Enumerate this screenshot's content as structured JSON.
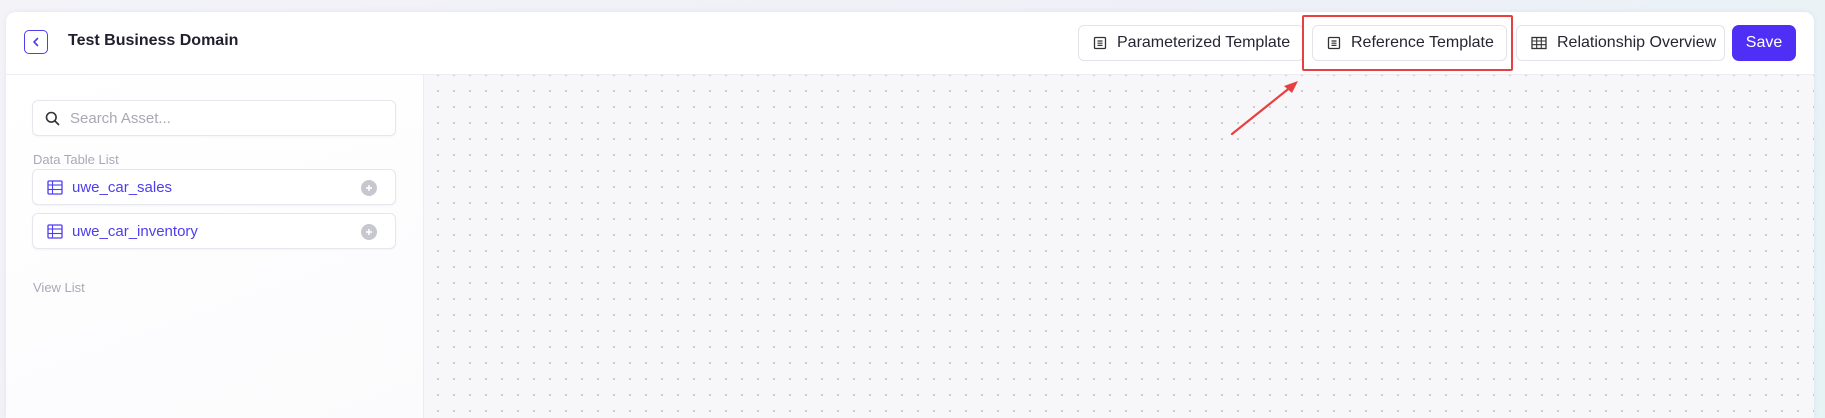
{
  "header": {
    "title": "Test Business Domain",
    "buttons": {
      "parameterized": "Parameterized Template",
      "reference": "Reference Template",
      "relationship": "Relationship Overview",
      "save": "Save"
    }
  },
  "sidebar": {
    "search_placeholder": "Search Asset...",
    "data_table_label": "Data Table List",
    "tables": [
      {
        "name": "uwe_car_sales"
      },
      {
        "name": "uwe_car_inventory"
      }
    ],
    "view_label": "View List"
  },
  "colors": {
    "accent": "#4f3df0",
    "save_bg": "#4f2ff5",
    "highlight": "#e84040"
  },
  "icons": {
    "back": "chevron-left-icon",
    "search": "search-icon",
    "template": "template-icon",
    "table": "table-icon",
    "add": "plus-circle-icon"
  }
}
